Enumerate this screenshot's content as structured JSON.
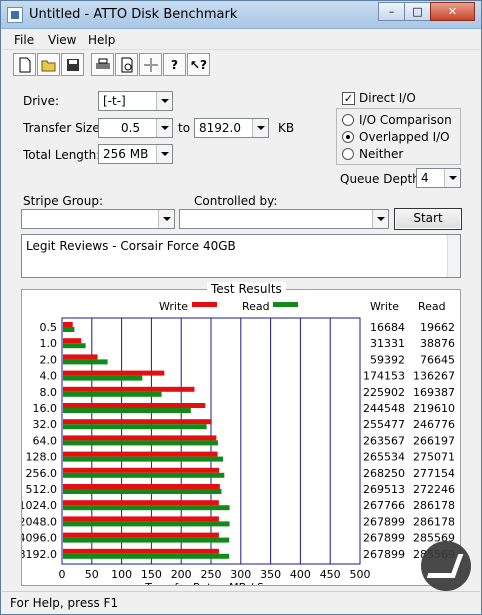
{
  "window": {
    "title": "Untitled - ATTO Disk Benchmark",
    "min": "–",
    "max": "□",
    "close": "✕"
  },
  "menu": [
    "File",
    "View",
    "Help"
  ],
  "toolbar_icons": [
    "new-icon",
    "open-icon",
    "save-icon",
    "print-icon",
    "print-preview-icon",
    "move-icon",
    "help-icon",
    "context-help-icon"
  ],
  "settings": {
    "drive_label": "Drive:",
    "drive_value": "[-t-]",
    "transfer_size_label": "Transfer Size:",
    "transfer_from": "0.5",
    "to_label": "to",
    "transfer_to": "8192.0",
    "unit": "KB",
    "total_length_label": "Total Length:",
    "total_length": "256 MB",
    "direct_io_label": "Direct I/O",
    "direct_io_checked": true,
    "io_comparison_label": "I/O Comparison",
    "overlapped_io_label": "Overlapped I/O",
    "neither_label": "Neither",
    "queue_depth_label": "Queue Depth:",
    "queue_depth_value": "4",
    "stripe_group_label": "Stripe Group:",
    "stripe_group_value": "",
    "controlled_by_label": "Controlled by:",
    "controlled_by_value": "",
    "start_label": "Start",
    "description": "Legit Reviews - Corsair Force 40GB"
  },
  "status": "For Help, press F1",
  "chart_data": {
    "type": "bar",
    "title": "Test Results",
    "xlabel": "Transfer Rate - MB / Sec",
    "xlim": [
      0,
      500
    ],
    "xticks": [
      0,
      50,
      100,
      150,
      200,
      250,
      300,
      350,
      400,
      450,
      500
    ],
    "legend": [
      "Write",
      "Read"
    ],
    "colors": {
      "write": "#e41010",
      "read": "#118a18",
      "grid": "#1a1a8c"
    },
    "table_headers": [
      "Write",
      "Read"
    ],
    "categories": [
      "0.5",
      "1.0",
      "2.0",
      "4.0",
      "8.0",
      "16.0",
      "32.0",
      "64.0",
      "128.0",
      "256.0",
      "512.0",
      "1024.0",
      "2048.0",
      "4096.0",
      "8192.0"
    ],
    "series": [
      {
        "name": "Write",
        "values": [
          16684,
          31331,
          59392,
          174153,
          225902,
          244548,
          255477,
          263567,
          265534,
          268250,
          269513,
          267766,
          267899,
          267899,
          267899
        ]
      },
      {
        "name": "Read",
        "values": [
          19662,
          38876,
          76645,
          136267,
          169387,
          219610,
          246776,
          266197,
          275071,
          277154,
          272246,
          286178,
          286178,
          285569,
          285569
        ]
      }
    ]
  }
}
